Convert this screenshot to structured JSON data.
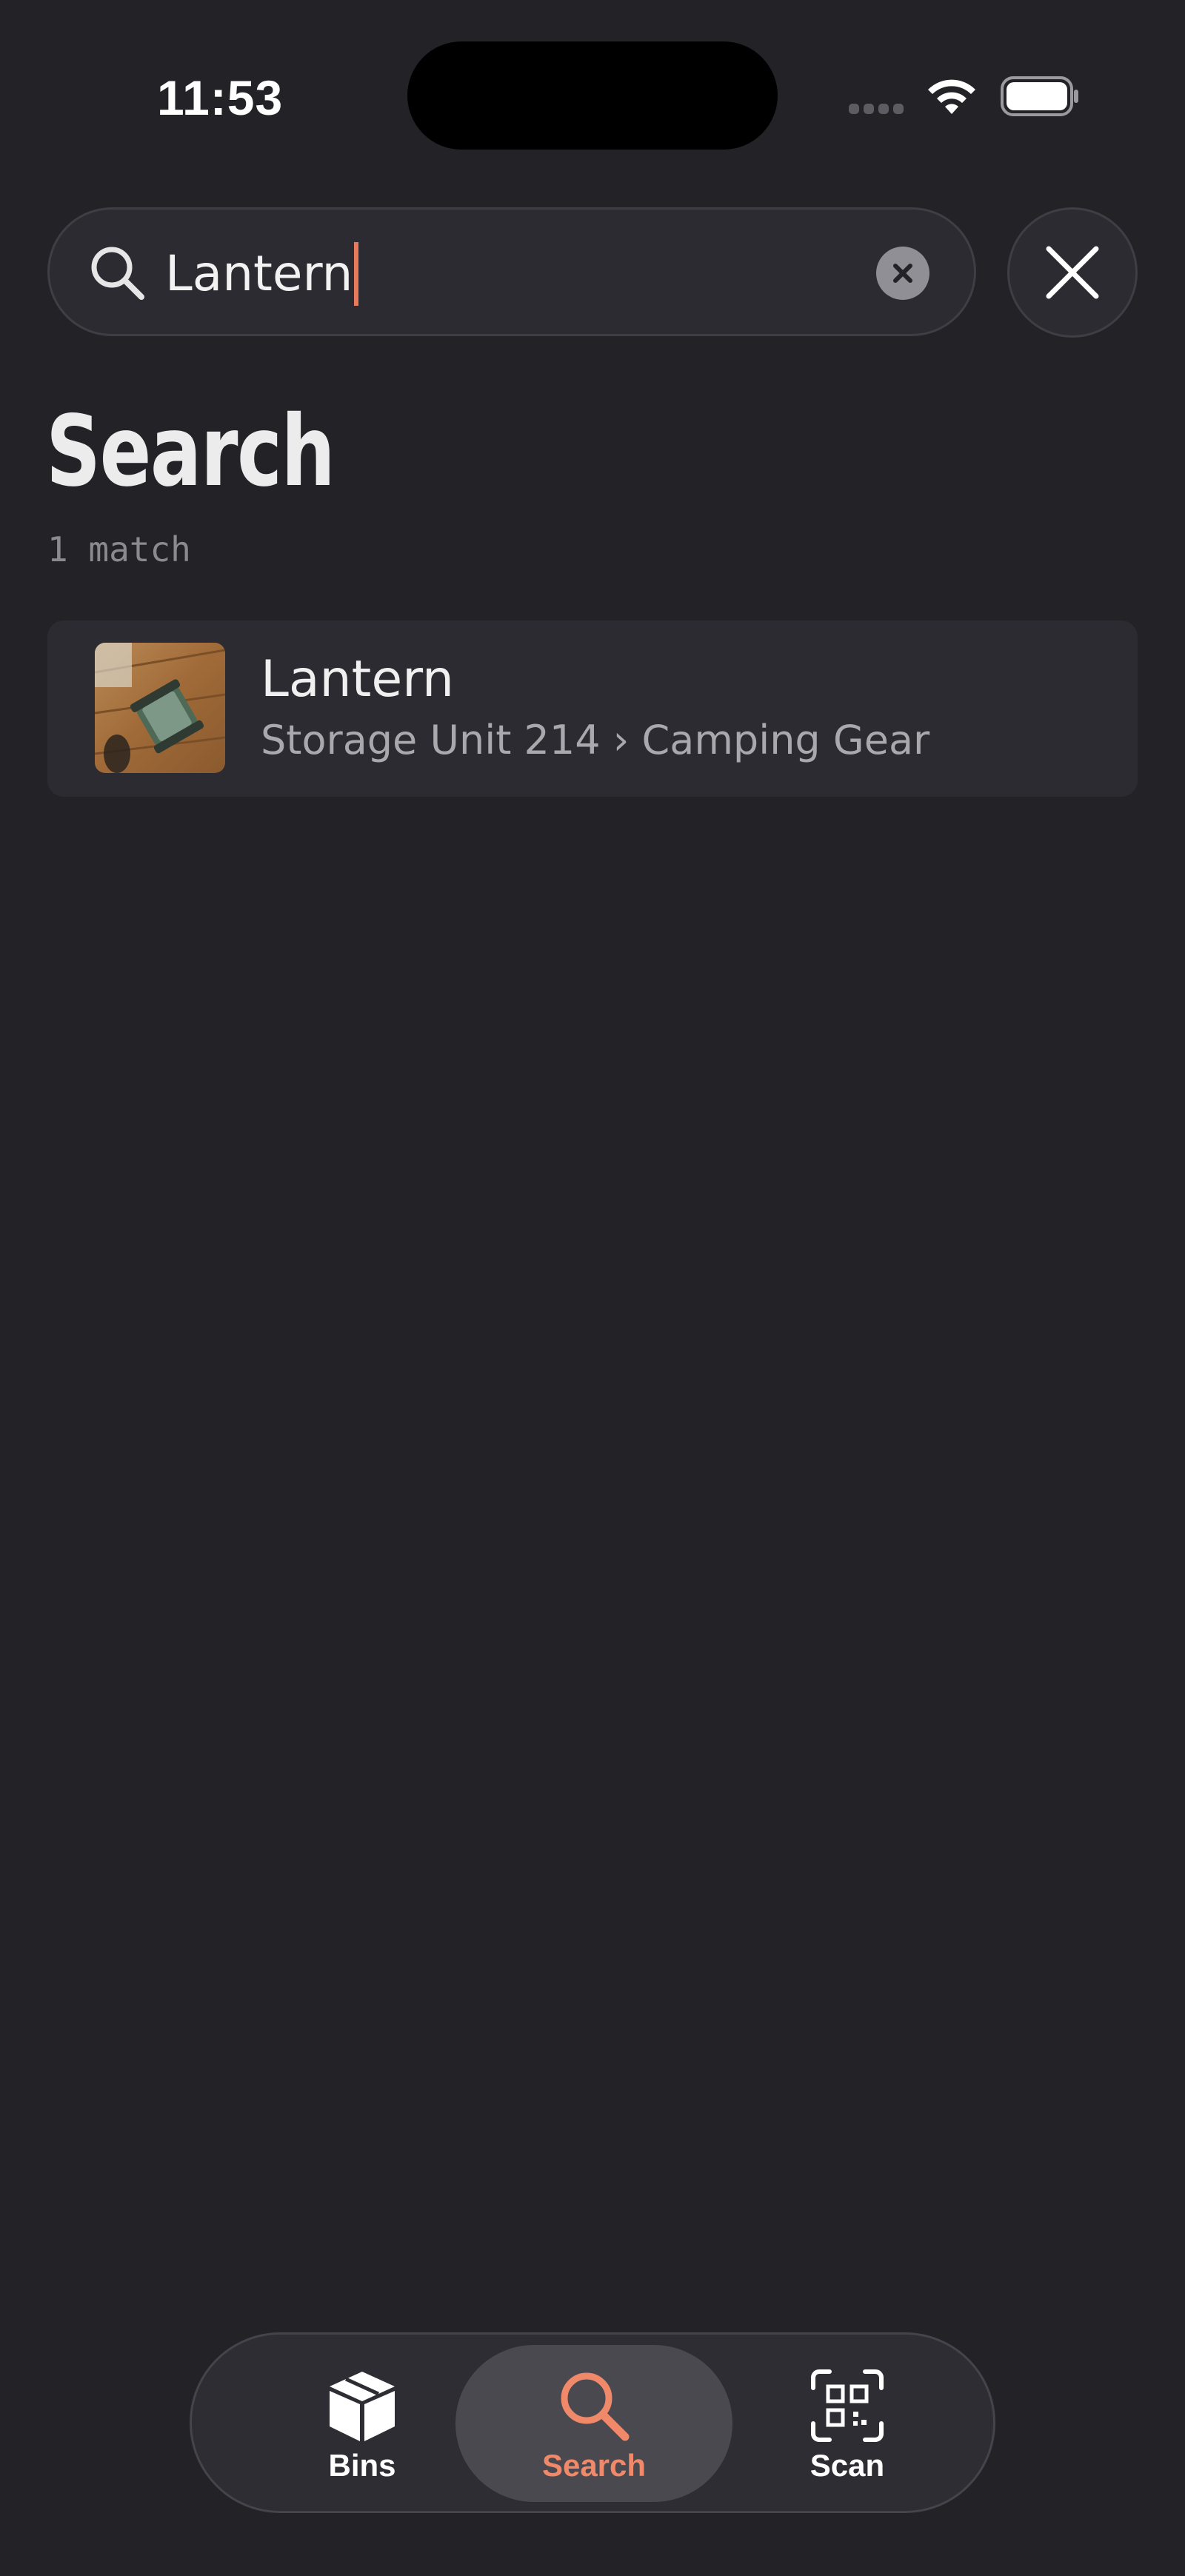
{
  "status_bar": {
    "time": "11:53"
  },
  "search": {
    "query": "Lantern",
    "clear_icon": "x-circle-icon",
    "close_icon": "close-icon",
    "search_icon": "search-icon"
  },
  "page": {
    "title": "Search",
    "match_count": "1 match"
  },
  "results": [
    {
      "title": "Lantern",
      "path": "Storage Unit 214 › Camping Gear",
      "thumbnail": "lantern-photo"
    }
  ],
  "tab_bar": {
    "tabs": [
      {
        "label": "Bins",
        "icon": "box-icon",
        "active": false
      },
      {
        "label": "Search",
        "icon": "search-icon",
        "active": true
      },
      {
        "label": "Scan",
        "icon": "qr-scan-icon",
        "active": false
      }
    ]
  },
  "colors": {
    "background": "#232227",
    "accent": "#f0896a",
    "caret": "#e8795a"
  }
}
